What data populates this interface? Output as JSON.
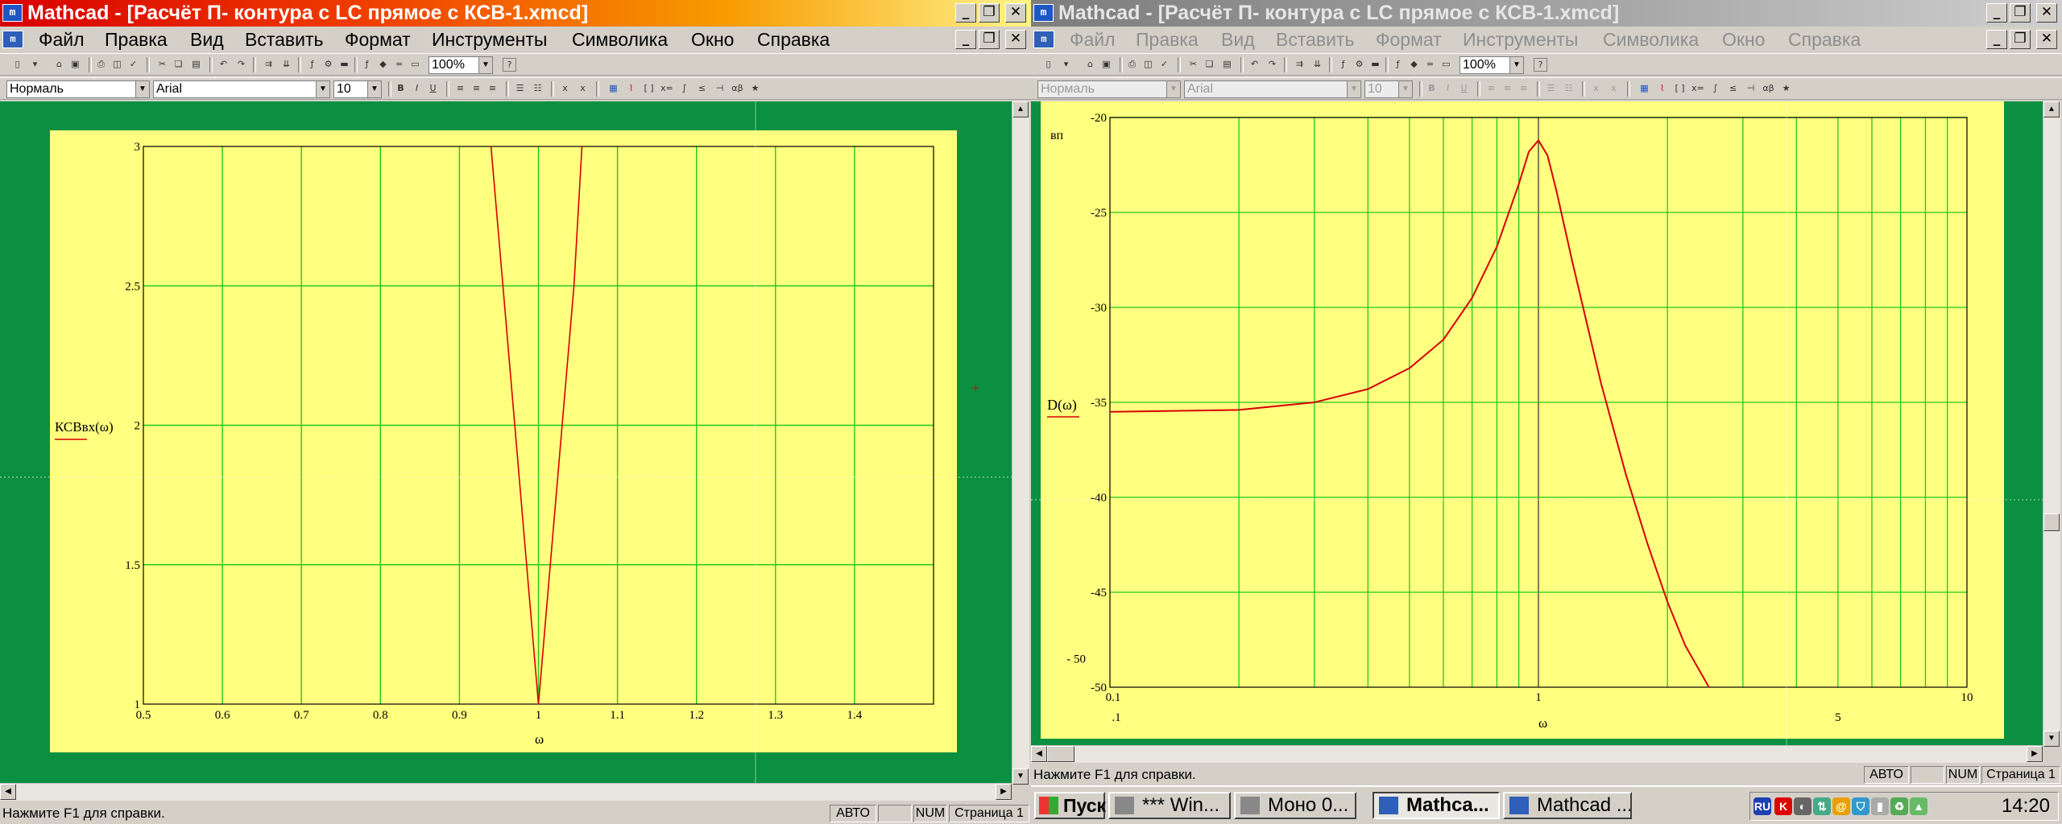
{
  "left_window": {
    "title": "Mathcad - [Расчёт П- контура с LC прямое с КСВ-1.xmcd]",
    "menu": [
      "Файл",
      "Правка",
      "Вид",
      "Вставить",
      "Формат",
      "Инструменты",
      "Символика",
      "Окно",
      "Справка"
    ],
    "zoom": "100%",
    "style_combo": "Нормаль",
    "font_combo": "Arial",
    "size_combo": "10",
    "status": {
      "hint": "Нажмите F1 для справки.",
      "mode": "АВТО",
      "num": "NUM",
      "page": "Страница 1"
    }
  },
  "right_window": {
    "title": "Mathcad - [Расчёт П- контура с LC прямое с КСВ-1.xmcd]",
    "menu": [
      "Файл",
      "Правка",
      "Вид",
      "Вставить",
      "Формат",
      "Инструменты",
      "Символика",
      "Окно",
      "Справка"
    ],
    "zoom": "100%",
    "style_combo": "Нормаль",
    "font_combo": "Arial",
    "size_combo": "10",
    "status": {
      "hint": "Нажмите F1 для справки.",
      "mode": "АВТО",
      "num": "NUM",
      "page": "Страница 1"
    }
  },
  "taskbar": {
    "start": "Пуск",
    "tasks": [
      "*** Win...",
      "Моно 0...",
      "Mathca...",
      "Mathcad ..."
    ],
    "lang": "RU",
    "clock": "14:20"
  },
  "colors": {
    "plot_bg": "#ffff80",
    "workspace_green": "#0a9040",
    "grid": "#20c820",
    "trace": "#d80000"
  },
  "chart_data": [
    {
      "type": "line",
      "ylabel": "КСВвх(ω)",
      "xlabel": "ω",
      "xlim": [
        0.5,
        1.5
      ],
      "ylim": [
        1,
        3
      ],
      "xticks": [
        0.5,
        0.6,
        0.7,
        0.8,
        0.9,
        1,
        1.1,
        1.2,
        1.3,
        1.4
      ],
      "yticks": [
        1,
        1.5,
        2,
        2.5,
        3
      ],
      "ytick_labels": [
        "1",
        "1.5",
        "2",
        "2.5",
        "3"
      ],
      "grid": true,
      "series": [
        {
          "x": [
            0.94,
            0.955,
            0.97,
            0.985,
            1.0,
            1.015,
            1.03,
            1.045,
            1.055
          ],
          "y": [
            3.0,
            2.5,
            2.0,
            1.5,
            1.0,
            1.5,
            2.0,
            2.5,
            3.0
          ]
        }
      ]
    },
    {
      "type": "line",
      "ylabel": "D(ω)",
      "xlabel": "ω",
      "unit_label": "вп",
      "xscale": "log",
      "xlim": [
        0.1,
        10
      ],
      "ylim": [
        -50,
        -20
      ],
      "xtick_labels": [
        "0.1",
        "1",
        "10"
      ],
      "x_lower_labels": [
        ".1",
        "5"
      ],
      "ytick_labels": [
        "-20",
        "-25",
        "-30",
        "-35",
        "-40",
        "-45",
        "- 50",
        "-50"
      ],
      "yticks": [
        -20,
        -25,
        -30,
        -35,
        -40,
        -45,
        -50
      ],
      "grid": true,
      "series": [
        {
          "x": [
            0.1,
            0.2,
            0.3,
            0.4,
            0.5,
            0.6,
            0.7,
            0.8,
            0.9,
            0.95,
            1.0,
            1.05,
            1.1,
            1.2,
            1.4,
            1.6,
            1.8,
            2.0,
            2.2,
            2.5
          ],
          "y": [
            -35.5,
            -35.4,
            -35.0,
            -34.3,
            -33.2,
            -31.7,
            -29.5,
            -26.8,
            -23.5,
            -21.8,
            -21.2,
            -22.0,
            -23.8,
            -27.6,
            -34.0,
            -38.8,
            -42.5,
            -45.5,
            -47.8,
            -50.0
          ]
        }
      ]
    }
  ]
}
